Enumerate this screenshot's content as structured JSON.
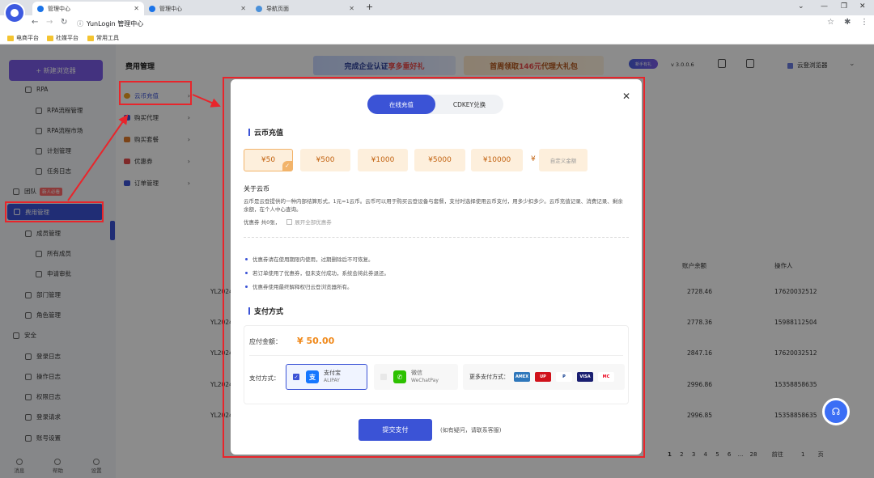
{
  "browser": {
    "tabs": [
      {
        "label": "管理中心",
        "active": true
      },
      {
        "label": "管理中心",
        "active": false
      },
      {
        "label": "导航页面",
        "active": false
      }
    ],
    "url_host": "YunLogin 管理中心",
    "bookmarks": [
      "电商平台",
      "社媒平台",
      "常用工具"
    ]
  },
  "sidebar": {
    "new_browser": "+ 新建浏览器",
    "items": [
      {
        "label": "RPA"
      },
      {
        "label": "RPA流程管理"
      },
      {
        "label": "RPA流程市场"
      },
      {
        "label": "计划管理"
      },
      {
        "label": "任务日志"
      },
      {
        "label": "团队",
        "badge": "新人必看"
      },
      {
        "label": "费用管理"
      },
      {
        "label": "成员管理"
      },
      {
        "label": "所有成员"
      },
      {
        "label": "申请审批"
      },
      {
        "label": "部门管理"
      },
      {
        "label": "角色管理"
      },
      {
        "label": "安全"
      },
      {
        "label": "登录日志"
      },
      {
        "label": "操作日志"
      },
      {
        "label": "权限日志"
      },
      {
        "label": "登录请求"
      },
      {
        "label": "账号设置"
      }
    ],
    "bottom": [
      "消息",
      "帮助",
      "设置"
    ]
  },
  "header": {
    "title": "费用管理",
    "banner1": "完成企业认证",
    "banner1_hl": "享多重好礼",
    "banner2": "首周领取",
    "banner2_hl": "146元",
    "banner2_tail": "代理大礼包",
    "badge": "新手有礼",
    "version": "v 3.0.0.6",
    "cloud_browser": "云登浏览器"
  },
  "submenu": [
    {
      "label": "云币充值",
      "color": "#f0a020"
    },
    {
      "label": "购买代理",
      "color": "#3b53d6"
    },
    {
      "label": "购买套餐",
      "color": "#e07a2a"
    },
    {
      "label": "优惠券",
      "color": "#e84b4b"
    },
    {
      "label": "订单管理",
      "color": "#3b53d6"
    }
  ],
  "table": {
    "rows": [
      {
        "id": "YL2024",
        "balance": "2728.46",
        "operator": "17620032512"
      },
      {
        "id": "YL2024",
        "balance": "2778.36",
        "operator": "15988112504"
      },
      {
        "id": "YL2024",
        "balance": "2847.16",
        "operator": "17620032512"
      },
      {
        "id": "YL2024",
        "balance": "2996.86",
        "operator": "15358858635"
      },
      {
        "id": "YL2024",
        "balance": "2996.85",
        "operator": "15358858635"
      }
    ],
    "headers": {
      "balance": "账户余额",
      "operator": "操作人"
    },
    "pager": {
      "pages": [
        "1",
        "2",
        "3",
        "4",
        "5",
        "6",
        "...",
        "28"
      ],
      "goto": "前往",
      "page_value": "1",
      "page_unit": "页"
    }
  },
  "modal": {
    "tabs": [
      "在线充值",
      "CDKEY兑换"
    ],
    "section_title": "云币充值",
    "amounts": [
      "¥50",
      "¥500",
      "¥1000",
      "¥5000",
      "¥10000"
    ],
    "selected_amount": "¥50",
    "custom_yen": "¥",
    "custom_placeholder": "自定义金额",
    "about_title": "关于云币",
    "about_text": "云币是云登提供的一种内部结算形式，1元=1云币。云币可以用于购买云登设备与套餐，支付时选择使用云币支付，用多少扣多少。云币充值记录、消费记录、剩余余额，在个人中心查询。",
    "coupon_label": "优惠券 共0张，",
    "coupon_toggle": "展开全部优惠券",
    "notes": [
      "优惠券请在使用期限内使用，过期删除后不可恢复。",
      "若订单使用了优惠券，但未支付成功，系统会将此券退还。",
      "优惠券使用最终解释权归云登浏览器所有。"
    ],
    "pay_title": "支付方式",
    "due_label": "应付金额：",
    "due_amount": "¥ 50.00",
    "pay_method_label": "支付方式：",
    "alipay": {
      "name": "支付宝",
      "sub": "ALIPAY"
    },
    "wechat": {
      "name": "微信",
      "sub": "WeChatPay"
    },
    "more_pay": "更多支付方式：",
    "cards": [
      {
        "name": "AMEX",
        "color": "#2e77bb"
      },
      {
        "name": "UP",
        "color": "#d0121b"
      },
      {
        "name": "P",
        "color": "#003087"
      },
      {
        "name": "VISA",
        "color": "#1a1f71"
      },
      {
        "name": "MC",
        "color": "#eb001b"
      }
    ],
    "submit": "提交支付",
    "submit_hint": "(如有疑问，请联系客服)"
  }
}
